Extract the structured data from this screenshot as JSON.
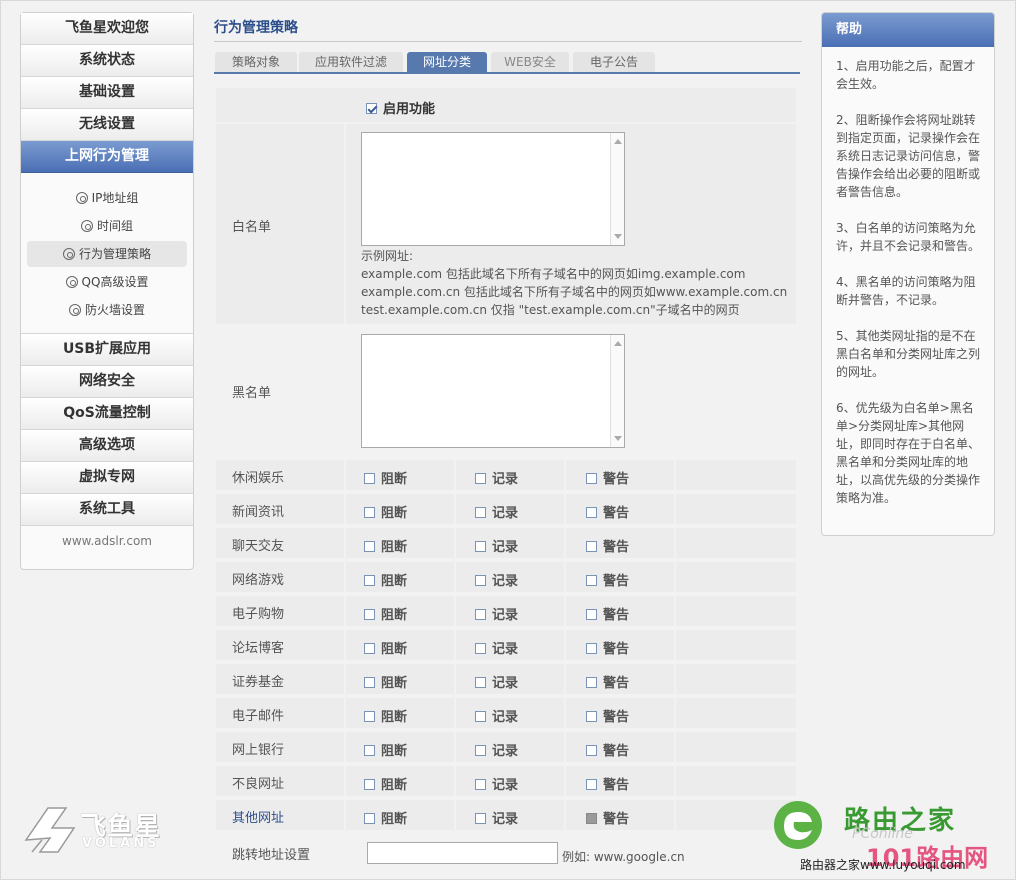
{
  "sidebar": {
    "top_items": [
      {
        "label": "飞鱼星欢迎您"
      },
      {
        "label": "系统状态"
      },
      {
        "label": "基础设置"
      },
      {
        "label": "无线设置"
      },
      {
        "label": "上网行为管理",
        "active": true
      }
    ],
    "sub_items": [
      {
        "label": "IP地址组"
      },
      {
        "label": "时间组"
      },
      {
        "label": "行为管理策略",
        "active": true
      },
      {
        "label": "QQ高级设置"
      },
      {
        "label": "防火墙设置"
      }
    ],
    "bottom_items": [
      {
        "label": "USB扩展应用"
      },
      {
        "label": "网络安全"
      },
      {
        "label": "QoS流量控制"
      },
      {
        "label": "高级选项"
      },
      {
        "label": "虚拟专网"
      },
      {
        "label": "系统工具"
      }
    ],
    "footer": "www.adslr.com"
  },
  "main": {
    "title": "行为管理策略",
    "tabs": [
      {
        "label": "策略对象"
      },
      {
        "label": "应用软件过滤"
      },
      {
        "label": "网址分类",
        "active": true
      },
      {
        "label": "WEB安全"
      },
      {
        "label": "电子公告"
      }
    ],
    "enable_label": "启用功能",
    "enable_checked": true,
    "whitelist_label": "白名单",
    "blacklist_label": "黑名单",
    "example_title": "示例网址:",
    "example_lines": [
      "example.com 包括此域名下所有子域名中的网页如img.example.com",
      "example.com.cn 包括此域名下所有子域名中的网页如www.example.com.cn",
      "test.example.com.cn 仅指 \"test.example.com.cn\"子域名中的网页"
    ],
    "option_labels": {
      "block": "阻断",
      "log": "记录",
      "warn": "警告"
    },
    "categories": [
      {
        "label": "休闲娱乐",
        "block": false,
        "log": false,
        "warn": false
      },
      {
        "label": "新闻资讯",
        "block": false,
        "log": false,
        "warn": false
      },
      {
        "label": "聊天交友",
        "block": false,
        "log": false,
        "warn": false
      },
      {
        "label": "网络游戏",
        "block": false,
        "log": false,
        "warn": false
      },
      {
        "label": "电子购物",
        "block": false,
        "log": false,
        "warn": false
      },
      {
        "label": "论坛博客",
        "block": false,
        "log": false,
        "warn": false
      },
      {
        "label": "证券基金",
        "block": false,
        "log": false,
        "warn": false
      },
      {
        "label": "电子邮件",
        "block": false,
        "log": false,
        "warn": false
      },
      {
        "label": "网上银行",
        "block": false,
        "log": false,
        "warn": false
      },
      {
        "label": "不良网址",
        "block": false,
        "log": false,
        "warn": false
      },
      {
        "label": "其他网址",
        "block": false,
        "log": false,
        "warn": false,
        "warn_disabled": true,
        "highlight": true
      }
    ],
    "redirect_label": "跳转地址设置",
    "redirect_value": "",
    "redirect_hint": "例如: www.google.cn"
  },
  "help": {
    "title": "帮助",
    "paragraphs": [
      "1、启用功能之后，配置才会生效。",
      "2、阻断操作会将网址跳转到指定页面，记录操作会在系统日志记录访问信息，警告操作会给出必要的阻断或者警告信息。",
      "3、白名单的访问策略为允许，并且不会记录和警告。",
      "4、黑名单的访问策略为阻断并警告，不记录。",
      "5、其他类网址指的是不在黑白名单和分类网址库之列的网址。",
      "6、优先级为白名单>黑名单>分类网址库>其他网址，即同时存在于白名单、黑名单和分类网址库的地址，以高优先级的分类操作策略为准。"
    ]
  },
  "branding": {
    "logo_cn": "飞鱼星",
    "logo_en": "VOLANS",
    "watermark_title": "路由之家",
    "watermark_mid": "PConline",
    "watermark_big": "101路由网",
    "watermark_bottom": "路由器之家www.luyouqi.com"
  },
  "colors": {
    "accent": "#4a6fb4",
    "title_blue": "#2c4f8b",
    "row_bg": "#ececec",
    "watermark_green": "#3a9a32"
  }
}
